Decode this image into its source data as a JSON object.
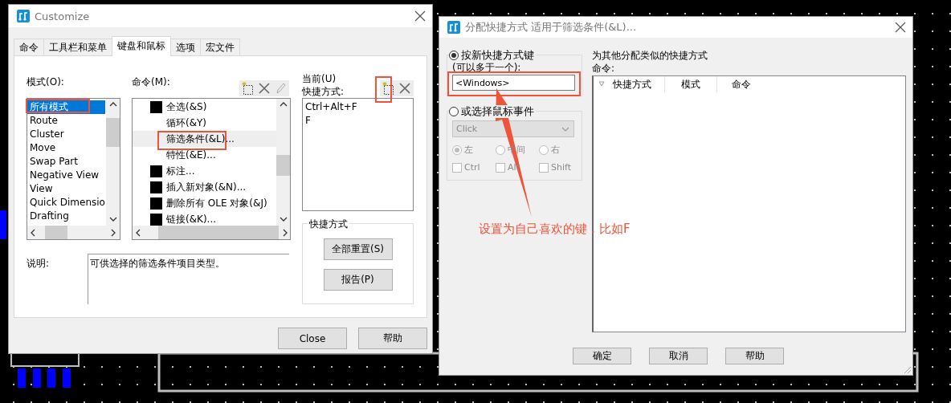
{
  "customize_dialog": {
    "title": "Customize",
    "tabs": [
      {
        "label": "命令",
        "selected": false
      },
      {
        "label": "工具栏和菜单",
        "selected": false
      },
      {
        "label": "键盘和鼠标",
        "selected": true
      },
      {
        "label": "选项",
        "selected": false
      },
      {
        "label": "宏文件",
        "selected": false
      }
    ],
    "mode_label": "模式(O):",
    "modes": [
      {
        "label": "所有模式",
        "selected": true
      },
      {
        "label": "Route",
        "selected": false
      },
      {
        "label": "Cluster",
        "selected": false
      },
      {
        "label": "Move",
        "selected": false
      },
      {
        "label": "Swap Part",
        "selected": false
      },
      {
        "label": "Negative View",
        "selected": false
      },
      {
        "label": "View",
        "selected": false
      },
      {
        "label": "Quick Dimensio",
        "selected": false
      },
      {
        "label": "Drafting",
        "selected": false
      }
    ],
    "command_label": "命令(M):",
    "commands": [
      {
        "label": "全选(&S)",
        "has_icon": true,
        "selected": false
      },
      {
        "label": "循环(&Y)",
        "has_icon": false,
        "selected": false
      },
      {
        "label": "筛选条件(&L)...",
        "has_icon": false,
        "selected": true
      },
      {
        "label": "特性(&E)...",
        "has_icon": false,
        "selected": false
      },
      {
        "label": "标注...",
        "has_icon": true,
        "selected": false
      },
      {
        "label": "插入新对象(&N)...",
        "has_icon": true,
        "selected": false
      },
      {
        "label": "删除所有 OLE 对象(&J)",
        "has_icon": true,
        "selected": false
      },
      {
        "label": "链接(&K)...",
        "has_icon": true,
        "selected": false
      }
    ],
    "current_label": "当前(U)",
    "shortcut_label": "快捷方式:",
    "current_shortcuts": [
      "Ctrl+Alt+F",
      "F"
    ],
    "shortcut_group": {
      "title": "快捷方式",
      "buttons": [
        "全部重置(S)",
        "报告(P)"
      ]
    },
    "description_label": "说明:",
    "description": "可供选择的筛选条件项目类型。",
    "buttons": [
      "Close",
      "帮助"
    ]
  },
  "assign_dialog": {
    "title": "分配快捷方式 适用于筛选条件(&L)...",
    "key_option": {
      "label": "按新快捷方式键",
      "sublabel": "(可以多于一个):",
      "selected": true,
      "value": "<Windows>"
    },
    "mouse_option": {
      "label": "或选择鼠标事件",
      "selected": false,
      "disabled": true,
      "event": "Click",
      "buttons": [
        {
          "label": "左",
          "selected": true
        },
        {
          "label": "中间",
          "selected": false
        },
        {
          "label": "右",
          "selected": false
        }
      ],
      "modifiers": [
        {
          "label": "Ctrl",
          "checked": false
        },
        {
          "label": "Alt",
          "checked": false
        },
        {
          "label": "Shift",
          "checked": false
        }
      ]
    },
    "similar_label": "为其他分配类似的快捷方式",
    "command_label": "命令:",
    "columns": [
      "快捷方式",
      "模式",
      "命令"
    ],
    "buttons": [
      "确定",
      "取消",
      "帮助"
    ]
  },
  "annotation": {
    "text": "设置为自己喜欢的键，比如F"
  }
}
